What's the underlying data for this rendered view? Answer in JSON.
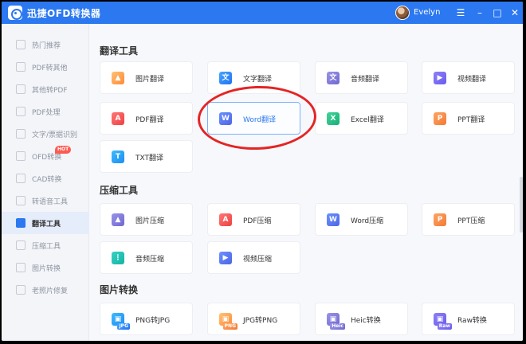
{
  "window": {
    "title": "迅捷OFD转换器",
    "user": "Evelyn",
    "icons": [
      "menu-icon",
      "minimize-icon",
      "maximize-icon",
      "close-icon"
    ]
  },
  "sidebar": {
    "items": [
      {
        "label": "热门推荐",
        "icon": "star-icon",
        "active": false
      },
      {
        "label": "PDF转其他",
        "icon": "pdf-icon",
        "active": false
      },
      {
        "label": "其他转PDF",
        "icon": "file-icon",
        "active": false
      },
      {
        "label": "PDF处理",
        "icon": "document-icon",
        "active": false
      },
      {
        "label": "文字/票据识别",
        "icon": "scan-icon",
        "active": false
      },
      {
        "label": "OFD转换",
        "icon": "ofd-icon",
        "active": false,
        "badge": "HOT"
      },
      {
        "label": "CAD转换",
        "icon": "cad-icon",
        "active": false
      },
      {
        "label": "转语音工具",
        "icon": "audio-icon",
        "active": false
      },
      {
        "label": "翻译工具",
        "icon": "translate-icon",
        "active": true
      },
      {
        "label": "压缩工具",
        "icon": "compress-icon",
        "active": false
      },
      {
        "label": "图片转换",
        "icon": "image-icon",
        "active": false
      },
      {
        "label": "老照片修复",
        "icon": "photo-icon",
        "active": false
      }
    ]
  },
  "sections": [
    {
      "title": "翻译工具",
      "tools": [
        {
          "label": "图片翻译",
          "glyph": "",
          "icon": "image-icon"
        },
        {
          "label": "文字翻译",
          "glyph": "文",
          "icon": "text-icon"
        },
        {
          "label": "音频翻译",
          "glyph": "文",
          "icon": "audio-icon"
        },
        {
          "label": "视频翻译",
          "glyph": "▶",
          "icon": "video-icon"
        },
        {
          "label": "PDF翻译",
          "glyph": "A",
          "icon": "pdf-icon"
        },
        {
          "label": "Word翻译",
          "glyph": "W",
          "icon": "word-icon"
        },
        {
          "label": "Excel翻译",
          "glyph": "X",
          "icon": "excel-icon"
        },
        {
          "label": "PPT翻译",
          "glyph": "P",
          "icon": "ppt-icon"
        },
        {
          "label": "TXT翻译",
          "glyph": "T",
          "icon": "txt-icon"
        }
      ]
    },
    {
      "title": "压缩工具",
      "tools": [
        {
          "label": "图片压缩",
          "glyph": "",
          "icon": "image-compress-icon"
        },
        {
          "label": "PDF压缩",
          "glyph": "A",
          "icon": "pdf-compress-icon"
        },
        {
          "label": "Word压缩",
          "glyph": "W",
          "icon": "word-compress-icon"
        },
        {
          "label": "PPT压缩",
          "glyph": "P",
          "icon": "ppt-compress-icon"
        },
        {
          "label": "音频压缩",
          "glyph": "⋮",
          "icon": "audio-compress-icon"
        },
        {
          "label": "视频压缩",
          "glyph": "▶",
          "icon": "video-compress-icon"
        }
      ]
    },
    {
      "title": "图片转换",
      "tools": [
        {
          "label": "PNG转JPG",
          "glyph": "",
          "pill": "JPG",
          "icon": "png-to-jpg-icon"
        },
        {
          "label": "JPG转PNG",
          "glyph": "",
          "pill": "PNG",
          "icon": "jpg-to-png-icon"
        },
        {
          "label": "Heic转换",
          "glyph": "",
          "pill": "Heic",
          "icon": "heic-icon"
        },
        {
          "label": "Raw转换",
          "glyph": "",
          "pill": "Raw",
          "icon": "raw-icon"
        }
      ]
    }
  ],
  "colors": {
    "brand": "#2b78f0",
    "annotation": "#e52424"
  }
}
